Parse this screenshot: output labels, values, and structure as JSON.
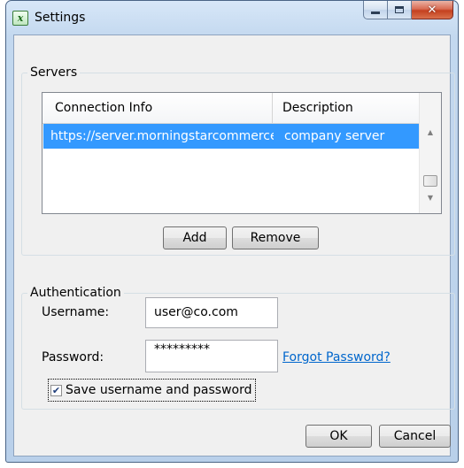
{
  "window": {
    "title": "Settings",
    "icon": "excel-icon",
    "icon_glyph": "x",
    "minimize_glyph": "",
    "close_glyph": "✕"
  },
  "servers": {
    "group_label": "Servers",
    "columns": [
      "Connection Info",
      "Description"
    ],
    "rows": [
      {
        "connection_info": "https://server.morningstarcommerce.com",
        "description": "company server",
        "selected": true
      }
    ],
    "add_label": "Add",
    "remove_label": "Remove",
    "scroll_up": "▲",
    "scroll_down": "▼"
  },
  "authentication": {
    "group_label": "Authentication",
    "username_label": "Username:",
    "username_value": "user@co.com",
    "password_label": "Password:",
    "password_value": "*********",
    "forgot_link": "Forgot Password?",
    "save_checkbox_label": "Save username and password",
    "save_checked": true,
    "check_glyph": "✔"
  },
  "footer": {
    "ok_label": "OK",
    "cancel_label": "Cancel"
  },
  "colors": {
    "selection": "#3399ff",
    "link": "#0066cc",
    "close_button": "#c4401f"
  }
}
